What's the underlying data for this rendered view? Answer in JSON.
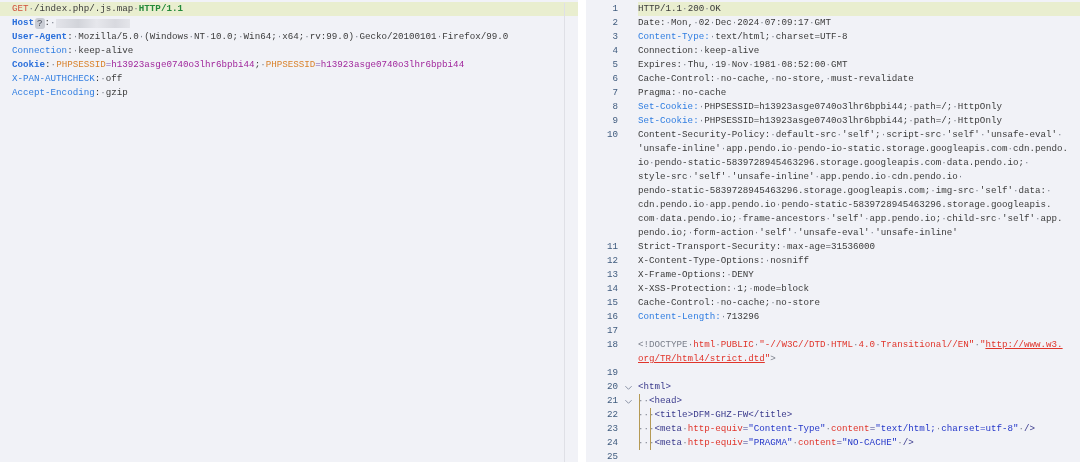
{
  "request": {
    "lines": [
      {
        "highlighted": true,
        "tokens": [
          {
            "kind": "method",
            "text": "GET"
          },
          {
            "kind": "plain",
            "text": "·/index.php/.js.map·"
          },
          {
            "kind": "version",
            "text": "HTTP/1.1"
          }
        ]
      },
      {
        "highlighted": false,
        "tokens": [
          {
            "kind": "key-strong",
            "text": "Host"
          },
          {
            "kind": "badge",
            "text": "?"
          },
          {
            "kind": "plain",
            "text": ":·"
          },
          {
            "kind": "redacted"
          }
        ]
      },
      {
        "highlighted": false,
        "tokens": [
          {
            "kind": "key-strong",
            "text": "User-Agent"
          },
          {
            "kind": "plain",
            "text": ":·Mozilla/5.0·(Windows·NT·10.0;·Win64;·x64;·rv:99.0)·Gecko/20100101·Firefox/99.0"
          }
        ]
      },
      {
        "highlighted": false,
        "tokens": [
          {
            "kind": "key",
            "text": "Connection"
          },
          {
            "kind": "plain",
            "text": ":·keep-alive"
          }
        ]
      },
      {
        "highlighted": false,
        "tokens": [
          {
            "kind": "key-strong",
            "text": "Cookie"
          },
          {
            "kind": "plain",
            "text": ":·"
          },
          {
            "kind": "cookie-name",
            "text": "PHPSESSID"
          },
          {
            "kind": "cookie-eq",
            "text": "="
          },
          {
            "kind": "cookie-value",
            "text": "h13923asge0740o3lhr6bpbi44"
          },
          {
            "kind": "plain",
            "text": ";·"
          },
          {
            "kind": "cookie-name",
            "text": "PHPSESSID"
          },
          {
            "kind": "cookie-eq",
            "text": "="
          },
          {
            "kind": "cookie-value",
            "text": "h13923asge0740o3lhr6bpbi44"
          }
        ]
      },
      {
        "highlighted": false,
        "tokens": [
          {
            "kind": "key",
            "text": "X-PAN-AUTHCHECK"
          },
          {
            "kind": "plain",
            "text": ":·off"
          }
        ]
      },
      {
        "highlighted": false,
        "tokens": [
          {
            "kind": "key",
            "text": "Accept-Encoding"
          },
          {
            "kind": "plain",
            "text": ":·gzip"
          }
        ]
      }
    ]
  },
  "response": {
    "lines": [
      {
        "number": "1",
        "highlighted": true,
        "wraps": [
          {
            "tokens": [
              {
                "kind": "plain",
                "text": "HTTP/1.1·200·OK"
              }
            ]
          }
        ]
      },
      {
        "number": "2",
        "highlighted": false,
        "wraps": [
          {
            "tokens": [
              {
                "kind": "plain",
                "text": "Date:·Mon,·02·Dec·2024·07:09:17·GMT"
              }
            ]
          }
        ]
      },
      {
        "number": "3",
        "highlighted": false,
        "wraps": [
          {
            "tokens": [
              {
                "kind": "key",
                "text": "Content-Type:"
              },
              {
                "kind": "plain",
                "text": "·text/html;·charset=UTF-8"
              }
            ]
          }
        ]
      },
      {
        "number": "4",
        "highlighted": false,
        "wraps": [
          {
            "tokens": [
              {
                "kind": "plain",
                "text": "Connection:·keep-alive"
              }
            ]
          }
        ]
      },
      {
        "number": "5",
        "highlighted": false,
        "wraps": [
          {
            "tokens": [
              {
                "kind": "plain",
                "text": "Expires:·Thu,·19·Nov·1981·08:52:00·GMT"
              }
            ]
          }
        ]
      },
      {
        "number": "6",
        "highlighted": false,
        "wraps": [
          {
            "tokens": [
              {
                "kind": "plain",
                "text": "Cache-Control:·no-cache,·no-store,·must-revalidate"
              }
            ]
          }
        ]
      },
      {
        "number": "7",
        "highlighted": false,
        "wraps": [
          {
            "tokens": [
              {
                "kind": "plain",
                "text": "Pragma:·no-cache"
              }
            ]
          }
        ]
      },
      {
        "number": "8",
        "highlighted": false,
        "wraps": [
          {
            "tokens": [
              {
                "kind": "key",
                "text": "Set-Cookie:"
              },
              {
                "kind": "plain",
                "text": "·PHPSESSID=h13923asge0740o3lhr6bpbi44;·path=/;·HttpOnly"
              }
            ]
          }
        ]
      },
      {
        "number": "9",
        "highlighted": false,
        "wraps": [
          {
            "tokens": [
              {
                "kind": "key",
                "text": "Set-Cookie:"
              },
              {
                "kind": "plain",
                "text": "·PHPSESSID=h13923asge0740o3lhr6bpbi44;·path=/;·HttpOnly"
              }
            ]
          }
        ]
      },
      {
        "number": "10",
        "highlighted": false,
        "wraps": [
          {
            "tokens": [
              {
                "kind": "plain",
                "text": "Content-Security-Policy:·default-src·'self';·script-src·'self'·'unsafe-eval'·"
              }
            ]
          },
          {
            "tokens": [
              {
                "kind": "plain",
                "text": "'unsafe-inline'·app.pendo.io·pendo-io-static.storage.googleapis.com·cdn.pendo."
              }
            ]
          },
          {
            "tokens": [
              {
                "kind": "plain",
                "text": "io·pendo-static-5839728945463296.storage.googleapis.com·data.pendo.io;·"
              }
            ]
          },
          {
            "tokens": [
              {
                "kind": "plain",
                "text": "style-src·'self'·'unsafe-inline'·app.pendo.io·cdn.pendo.io·"
              }
            ]
          },
          {
            "tokens": [
              {
                "kind": "plain",
                "text": "pendo-static-5839728945463296.storage.googleapis.com;·img-src·'self'·data:·"
              }
            ]
          },
          {
            "tokens": [
              {
                "kind": "plain",
                "text": "cdn.pendo.io·app.pendo.io·pendo-static-5839728945463296.storage.googleapis."
              }
            ]
          },
          {
            "tokens": [
              {
                "kind": "plain",
                "text": "com·data.pendo.io;·frame-ancestors·'self'·app.pendo.io;·child-src·'self'·app."
              }
            ]
          },
          {
            "tokens": [
              {
                "kind": "plain",
                "text": "pendo.io;·form-action·'self'·'unsafe-eval'·'unsafe-inline'"
              }
            ]
          }
        ]
      },
      {
        "number": "11",
        "highlighted": false,
        "wraps": [
          {
            "tokens": [
              {
                "kind": "plain",
                "text": "Strict-Transport-Security:·max-age=31536000"
              }
            ]
          }
        ]
      },
      {
        "number": "12",
        "highlighted": false,
        "wraps": [
          {
            "tokens": [
              {
                "kind": "plain",
                "text": "X-Content-Type-Options:·nosniff"
              }
            ]
          }
        ]
      },
      {
        "number": "13",
        "highlighted": false,
        "wraps": [
          {
            "tokens": [
              {
                "kind": "plain",
                "text": "X-Frame-Options:·DENY"
              }
            ]
          }
        ]
      },
      {
        "number": "14",
        "highlighted": false,
        "wraps": [
          {
            "tokens": [
              {
                "kind": "plain",
                "text": "X-XSS-Protection:·1;·mode=block"
              }
            ]
          }
        ]
      },
      {
        "number": "15",
        "highlighted": false,
        "wraps": [
          {
            "tokens": [
              {
                "kind": "plain",
                "text": "Cache-Control:·no-cache;·no-store"
              }
            ]
          }
        ]
      },
      {
        "number": "16",
        "highlighted": false,
        "wraps": [
          {
            "tokens": [
              {
                "kind": "key",
                "text": "Content-Length:"
              },
              {
                "kind": "plain",
                "text": "·713296"
              }
            ]
          }
        ]
      },
      {
        "number": "17",
        "highlighted": false
      },
      {
        "number": "18",
        "highlighted": false,
        "wraps": [
          {
            "tokens": [
              {
                "kind": "doctype",
                "text": "<!DOCTYPE·"
              },
              {
                "kind": "attr",
                "text": "html·PUBLIC·\"-//W3C//DTD·HTML·4.0·Transitional//EN\"·\""
              },
              {
                "kind": "link",
                "text": "http://www.w3."
              }
            ]
          },
          {
            "tokens": [
              {
                "kind": "link",
                "text": "org/TR/html4/strict.dtd"
              },
              {
                "kind": "attr",
                "text": "\""
              },
              {
                "kind": "doctype",
                "text": ">"
              }
            ]
          }
        ]
      },
      {
        "number": "19",
        "highlighted": false
      },
      {
        "number": "20",
        "highlighted": false,
        "expanded": true,
        "wraps": [
          {
            "tokens": [
              {
                "kind": "tag",
                "text": "<html>"
              }
            ]
          }
        ]
      },
      {
        "number": "21",
        "highlighted": false,
        "expanded": true,
        "wraps": [
          {
            "tokens": [
              {
                "kind": "tag",
                "text": "··<head>"
              }
            ]
          }
        ]
      },
      {
        "number": "22",
        "highlighted": false,
        "wraps": [
          {
            "tokens": [
              {
                "kind": "tag",
                "text": "···<title>DFM-GHZ-FW</title>"
              }
            ]
          }
        ]
      },
      {
        "number": "23",
        "highlighted": false,
        "wraps": [
          {
            "tokens": [
              {
                "kind": "tag",
                "text": "···<meta·"
              },
              {
                "kind": "attr",
                "text": "http-equiv"
              },
              {
                "kind": "tag",
                "text": "="
              },
              {
                "kind": "string",
                "text": "\"Content-Type\"·"
              },
              {
                "kind": "attr",
                "text": "content"
              },
              {
                "kind": "tag",
                "text": "="
              },
              {
                "kind": "string",
                "text": "\"text/html;·charset=utf-8\""
              },
              {
                "kind": "tag",
                "text": "·/>"
              }
            ]
          }
        ]
      },
      {
        "number": "24",
        "highlighted": false,
        "wraps": [
          {
            "tokens": [
              {
                "kind": "tag",
                "text": "···<meta·"
              },
              {
                "kind": "attr",
                "text": "http-equiv"
              },
              {
                "kind": "tag",
                "text": "="
              },
              {
                "kind": "string",
                "text": "\"PRAGMA\"·"
              },
              {
                "kind": "attr",
                "text": "content"
              },
              {
                "kind": "tag",
                "text": "="
              },
              {
                "kind": "string",
                "text": "\"NO-CACHE\""
              },
              {
                "kind": "tag",
                "text": "·/>"
              }
            ]
          }
        ]
      },
      {
        "number": "25",
        "highlighted": false
      }
    ]
  }
}
